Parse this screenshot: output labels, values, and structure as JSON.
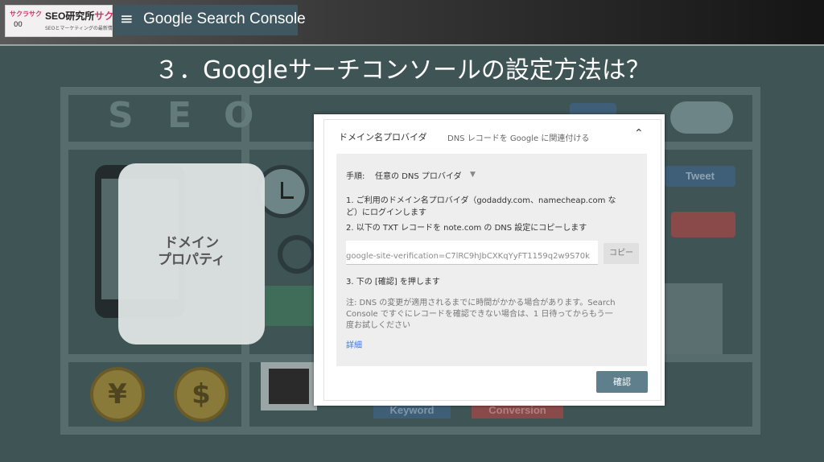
{
  "header": {
    "logo_mini": "サクラサク",
    "logo_circles": "OO",
    "logo_main_prefix": "SEO研究所",
    "logo_main_accent": "サク",
    "logo_sub": "SEOとマーケティングの最新情報",
    "app_menu_icon": "hamburger-menu-icon",
    "app_title": "Google Search Console"
  },
  "slide": {
    "title": "３．Googleサーチコンソールの設定方法は？"
  },
  "illustration": {
    "seo_letters": [
      "S",
      "E",
      "O"
    ],
    "coin_yen": "¥",
    "coin_dollar": "$",
    "tweet": "Tweet",
    "keyword": "Keyword",
    "conversion": "Conversion",
    "colors": {
      "background": "#3e5455",
      "sprue": "#566c6d"
    }
  },
  "domain_card": {
    "line1": "ドメイン",
    "line2": "プロパティ"
  },
  "dialog": {
    "header_label": "ドメイン名プロバイダ",
    "header_desc": "DNS レコードを Google に関連付ける",
    "collapse_icon": "chevron-up-icon",
    "step_label": "手順:",
    "step_value": "任意の DNS プロバイダ",
    "instruction1_line1": "1. ご利用のドメイン名プロバイダ（godaddy.com、namecheap.com な",
    "instruction1_line2": "ど）にログインします",
    "instruction2": "2. 以下の TXT レコードを note.com の DNS 設定にコピーします",
    "txt_record": "google-site-verification=C7lRC9hJbCXKqYyFT1159q2w9S70k",
    "copy_button": "コピー",
    "instruction3": "3. 下の [確認] を押します",
    "note_line1": "注: DNS の変更が適用されるまでに時間がかかる場合があります。Search",
    "note_line2": "Console ですぐにレコードを確認できない場合は、1 日待ってからもう一",
    "note_line3": "度お試しください",
    "details_link": "詳細",
    "confirm_button": "確認",
    "colors": {
      "link": "#3b78e7",
      "confirm": "#5f7f8c"
    }
  }
}
